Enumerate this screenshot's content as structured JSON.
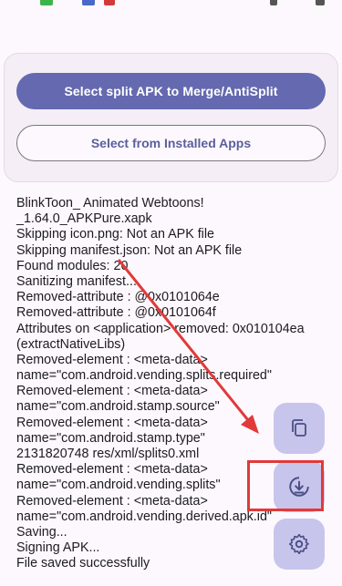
{
  "buttons": {
    "select_split": "Select split APK to Merge/AntiSplit",
    "select_installed": "Select from Installed Apps"
  },
  "log_lines": [
    "BlinkToon_ Animated Webtoons!",
    "_1.64.0_APKPure.xapk",
    "Skipping icon.png: Not an APK file",
    "Skipping manifest.json: Not an APK file",
    "Found modules: 20",
    "Sanitizing manifest...",
    "Removed-attribute : @0x0101064e",
    "Removed-attribute : @0x0101064f",
    "Attributes on <application> removed: 0x010104ea",
    "(extractNativeLibs)",
    "Removed-element : <meta-data>",
    "name=\"com.android.vending.splits.required\"",
    "Removed-element : <meta-data>",
    "name=\"com.android.stamp.source\"",
    "Removed-element : <meta-data>",
    "name=\"com.android.stamp.type\"",
    "2131820748 res/xml/splits0.xml",
    "Removed-element : <meta-data>",
    "name=\"com.android.vending.splits\"",
    "Removed-element : <meta-data>",
    "name=\"com.android.vending.derived.apk.id\"",
    "Saving...",
    "Signing APK...",
    "File saved successfully"
  ],
  "fabs": {
    "copy_icon": "copy-icon",
    "download_icon": "download-icon",
    "settings_icon": "gear-icon"
  },
  "colors": {
    "primary": "#6469b0",
    "fab": "#c7c5ec",
    "annotation": "#e03a3a"
  }
}
